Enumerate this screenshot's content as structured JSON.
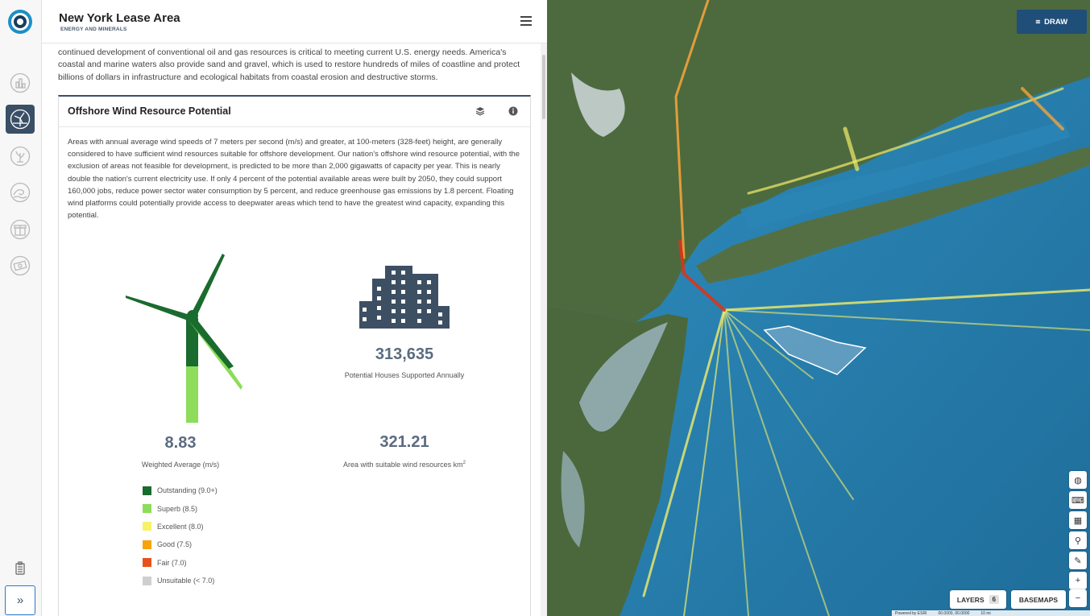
{
  "app": {
    "title": "New York Lease Area",
    "subtitle": "ENERGY AND MINERALS"
  },
  "intro_text": "are currently planned for the Atlantic coast. Hawaii and California are also considering wind projects. At the same time, the continued development of conventional oil and gas resources is critical to meeting current U.S. energy needs. America's coastal and marine waters also provide sand and gravel, which is used to restore hundreds of miles of coastline and protect billions of dollars in infrastructure and ecological habitats from coastal erosion and destructive storms.",
  "card": {
    "title": "Offshore Wind Resource Potential",
    "body": "Areas with annual average wind speeds of 7 meters per second (m/s) and greater, at 100-meters (328-feet) height, are generally considered to have sufficient wind resources suitable for offshore development. Our nation's offshore wind resource potential, with the exclusion of areas not feasible for development, is predicted to be more than 2,000 gigawatts of capacity per year. This is nearly double the nation's current electricity use. If only 4 percent of the potential available areas were built by 2050, they could support 160,000 jobs, reduce power sector water consumption by 5 percent, and reduce greenhouse gas emissions by 1.8 percent. Floating wind platforms could potentially provide access to deepwater areas which tend to have the greatest wind capacity, expanding this potential."
  },
  "stats": {
    "houses_value": "313,635",
    "houses_label": "Potential Houses Supported Annually",
    "wind_value": "8.83",
    "wind_label": "Weighted Average (m/s)",
    "area_value": "321.21",
    "area_label": "Area with suitable wind resources km",
    "area_unit_sup": "2"
  },
  "legend": [
    {
      "label": "Outstanding (9.0+)",
      "color": "#1a6b2e"
    },
    {
      "label": "Superb (8.5)",
      "color": "#8ddc5a"
    },
    {
      "label": "Excellent (8.0)",
      "color": "#f7f26a"
    },
    {
      "label": "Good (7.5)",
      "color": "#f5a40c"
    },
    {
      "label": "Fair (7.0)",
      "color": "#e8501a"
    },
    {
      "label": "Unsuitable (< 7.0)",
      "color": "#cfcfcf"
    }
  ],
  "map": {
    "draw_label": "DRAW",
    "layers_label": "LAYERS",
    "layers_count": "6",
    "basemaps_label": "BASEMAPS",
    "zoom_in": "+",
    "zoom_out": "−",
    "attribution": "Powered by ESRI",
    "coords": "00.0000, 00.0000",
    "scale": "10 mi"
  }
}
